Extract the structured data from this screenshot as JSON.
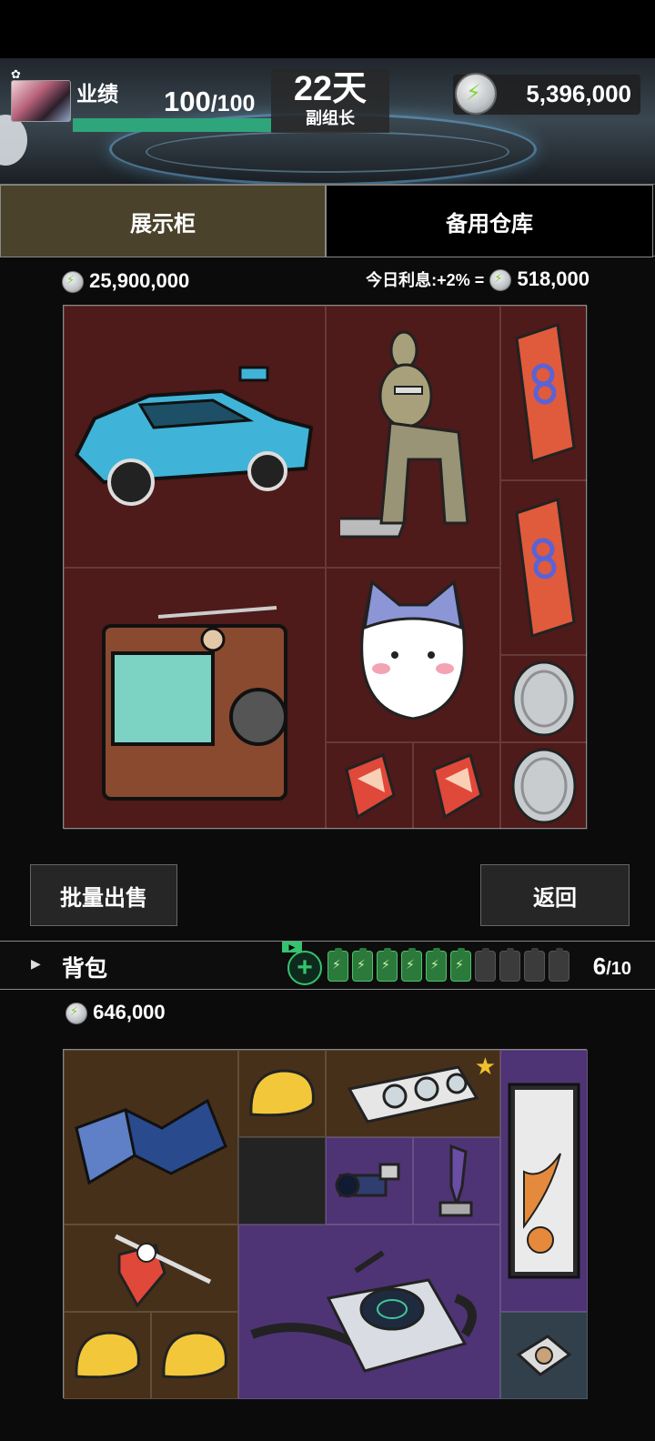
{
  "header": {
    "performance_label": "业绩",
    "performance_current": "100",
    "performance_max": "/100",
    "performance_fraction": 1.0,
    "days": "22天",
    "rank": "副组长",
    "coins": "5,396,000"
  },
  "tabs": {
    "showcase": "展示柜",
    "warehouse": "备用仓库"
  },
  "showcase": {
    "total_value": "25,900,000",
    "interest_label": "今日利息:+2% =",
    "interest_value": "518,000",
    "items": [
      {
        "name": "blue-sports-car",
        "icon": "car"
      },
      {
        "name": "statue-figure",
        "icon": "statue"
      },
      {
        "name": "meta-card-1",
        "icon": "card"
      },
      {
        "name": "meta-card-2",
        "icon": "card"
      },
      {
        "name": "retro-tv",
        "icon": "tv"
      },
      {
        "name": "cat-plush",
        "icon": "cat"
      },
      {
        "name": "silver-coin-1",
        "icon": "coin"
      },
      {
        "name": "silver-coin-2",
        "icon": "coin"
      },
      {
        "name": "red-crystal-1",
        "icon": "crystal"
      },
      {
        "name": "red-crystal-2",
        "icon": "crystal"
      }
    ]
  },
  "buttons": {
    "bulk_sell": "批量出售",
    "back": "返回"
  },
  "backpack": {
    "title": "背包",
    "capacity_used": "6",
    "capacity_max": "/10",
    "batteries_full": 6,
    "batteries_total": 10,
    "total_value": "646,000"
  },
  "colors": {
    "accent_green": "#2fa57c",
    "tab_active": "#4a422b",
    "showcase_bg": "#4e1a1a",
    "bag_purple": "#4e3474"
  }
}
